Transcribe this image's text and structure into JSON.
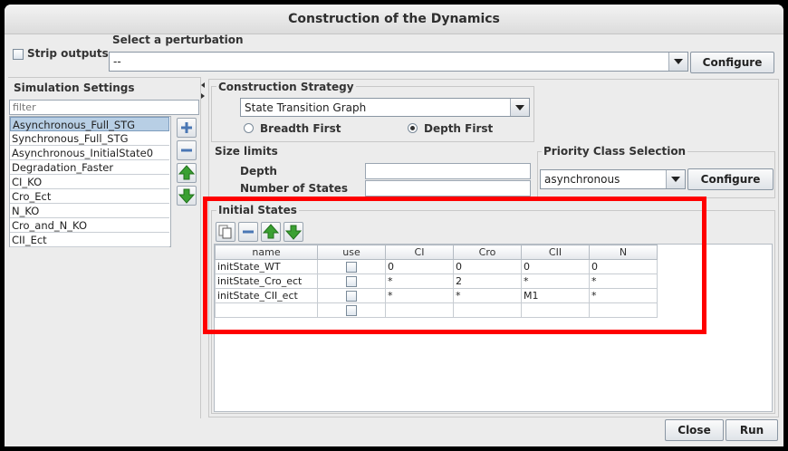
{
  "window": {
    "title": "Construction of the Dynamics"
  },
  "strip_outputs": {
    "label": "Strip outputs",
    "checked": false
  },
  "perturbation": {
    "section_label": "Select a perturbation",
    "selected": "--",
    "configure_label": "Configure"
  },
  "simulation_settings": {
    "header": "Simulation Settings",
    "filter_placeholder": "filter",
    "items": [
      {
        "label": "Asynchronous_Full_STG",
        "selected": true
      },
      {
        "label": "Synchronous_Full_STG",
        "selected": false
      },
      {
        "label": "Asynchronous_InitialState0",
        "selected": false
      },
      {
        "label": "Degradation_Faster",
        "selected": false
      },
      {
        "label": "CI_KO",
        "selected": false
      },
      {
        "label": "Cro_Ect",
        "selected": false
      },
      {
        "label": "N_KO",
        "selected": false
      },
      {
        "label": "Cro_and_N_KO",
        "selected": false
      },
      {
        "label": "CII_Ect",
        "selected": false
      }
    ],
    "buttons": {
      "add_icon": "plus-icon",
      "remove_icon": "minus-icon",
      "up_icon": "arrow-up-icon",
      "down_icon": "arrow-down-icon"
    }
  },
  "construction_strategy": {
    "label": "Construction Strategy",
    "selected": "State Transition Graph",
    "breadth_first_label": "Breadth First",
    "depth_first_label": "Depth First",
    "selected_order": "Depth First"
  },
  "size_limits": {
    "label": "Size limits",
    "depth_label": "Depth",
    "depth_value": "",
    "states_label": "Number of States",
    "states_value": ""
  },
  "priority": {
    "label": "Priority Class Selection",
    "selected": "asynchronous",
    "configure_label": "Configure"
  },
  "initial_states": {
    "label": "Initial States",
    "columns": [
      "name",
      "use",
      "CI",
      "Cro",
      "CII",
      "N"
    ],
    "rows": [
      {
        "name": "initState_WT",
        "use": false,
        "CI": "0",
        "Cro": "0",
        "CII": "0",
        "N": "0"
      },
      {
        "name": "initState_Cro_ect",
        "use": false,
        "CI": "*",
        "Cro": "2",
        "CII": "*",
        "N": "*"
      },
      {
        "name": "initState_CII_ect",
        "use": false,
        "CI": "*",
        "Cro": "*",
        "CII": "M1",
        "N": "*"
      },
      {
        "name": "",
        "use": false,
        "CI": "",
        "Cro": "",
        "CII": "",
        "N": ""
      }
    ]
  },
  "footer": {
    "close_label": "Close",
    "run_label": "Run"
  },
  "highlight": {
    "color": "#ff0000"
  }
}
